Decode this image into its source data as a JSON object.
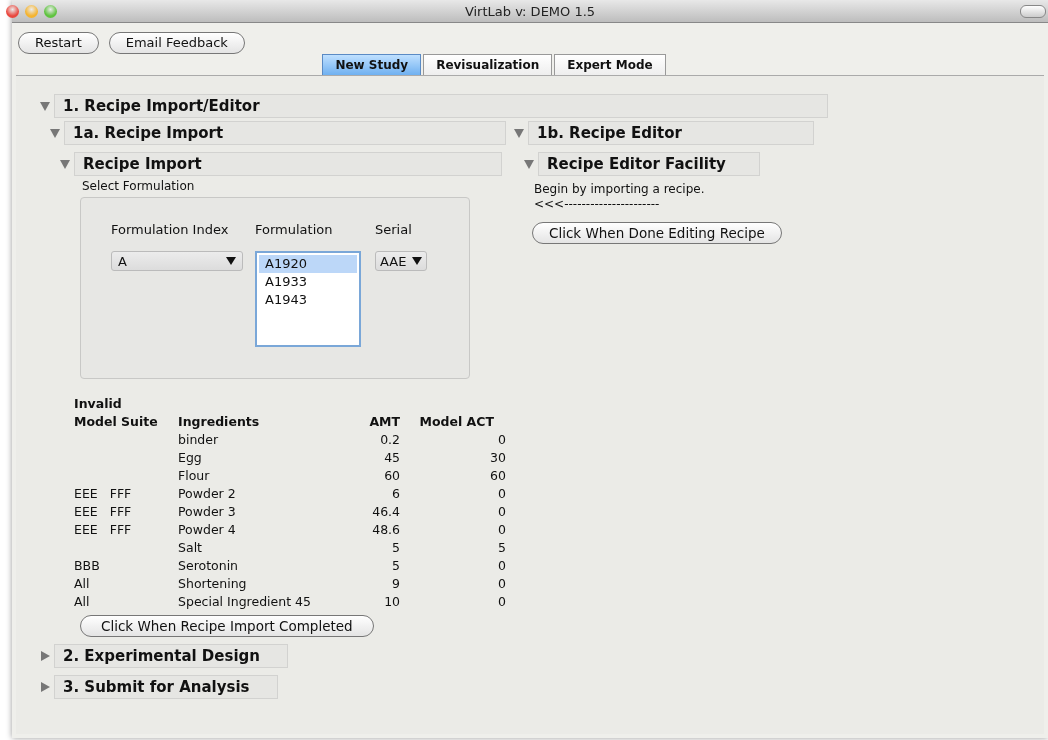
{
  "window": {
    "title": "VirtLab v: DEMO 1.5"
  },
  "toolbar": [
    "Restart",
    "Email Feedback"
  ],
  "tabs": [
    {
      "label": "New Study",
      "selected": true
    },
    {
      "label": "Revisualization",
      "selected": false
    },
    {
      "label": "Expert Mode",
      "selected": false
    }
  ],
  "sections": [
    {
      "title": "1. Recipe Import/Editor",
      "expanded": true,
      "children": [
        {
          "title": "1a. Recipe Import",
          "expanded": true,
          "panel": {
            "kind": "import",
            "title": "Recipe Import",
            "expanded": true,
            "group_label": "Select Formulation",
            "index_label": "Formulation Index",
            "index_value": "A",
            "formulation_label": "Formulation",
            "formulations": [
              {
                "label": "A1920",
                "selected": true
              },
              {
                "label": "A1933",
                "selected": false
              },
              {
                "label": "A1943",
                "selected": false
              }
            ],
            "serial_label": "Serial",
            "serial_value": "AAE",
            "table": {
              "columns": [
                [
                  "Invalid",
                  "Model Suite"
                ],
                [
                  "Ingredients"
                ],
                [
                  "AMT"
                ],
                [
                  "Model ACT"
                ]
              ],
              "rows": [
                {
                  "suite": [],
                  "ingredient": "binder",
                  "amt": "0.2",
                  "act": "0"
                },
                {
                  "suite": [],
                  "ingredient": "Egg",
                  "amt": "45",
                  "act": "30"
                },
                {
                  "suite": [],
                  "ingredient": "Flour",
                  "amt": "60",
                  "act": "60"
                },
                {
                  "suite": [
                    "EEE",
                    "FFF"
                  ],
                  "ingredient": "Powder 2",
                  "amt": "6",
                  "act": "0"
                },
                {
                  "suite": [
                    "EEE",
                    "FFF"
                  ],
                  "ingredient": "Powder 3",
                  "amt": "46.4",
                  "act": "0"
                },
                {
                  "suite": [
                    "EEE",
                    "FFF"
                  ],
                  "ingredient": "Powder 4",
                  "amt": "48.6",
                  "act": "0"
                },
                {
                  "suite": [],
                  "ingredient": "Salt",
                  "amt": "5",
                  "act": "5"
                },
                {
                  "suite": [
                    "BBB"
                  ],
                  "ingredient": "Serotonin",
                  "amt": "5",
                  "act": "0"
                },
                {
                  "suite": [
                    "All"
                  ],
                  "ingredient": "Shortening",
                  "amt": "9",
                  "act": "0"
                },
                {
                  "suite": [
                    "All"
                  ],
                  "ingredient": "Special Ingredient 45",
                  "amt": "10",
                  "act": "0"
                }
              ]
            },
            "button": "Click When Recipe Import Completed"
          }
        },
        {
          "title": "1b. Recipe Editor",
          "expanded": true,
          "panel": {
            "kind": "editor",
            "title": "Recipe Editor Facility",
            "expanded": true,
            "lines": [
              "Begin by importing a recipe.",
              "<<<----------------------"
            ],
            "button": "Click When Done Editing Recipe"
          }
        }
      ]
    },
    {
      "title": "2. Experimental Design",
      "expanded": false
    },
    {
      "title": "3. Submit for Analysis",
      "expanded": false
    }
  ]
}
